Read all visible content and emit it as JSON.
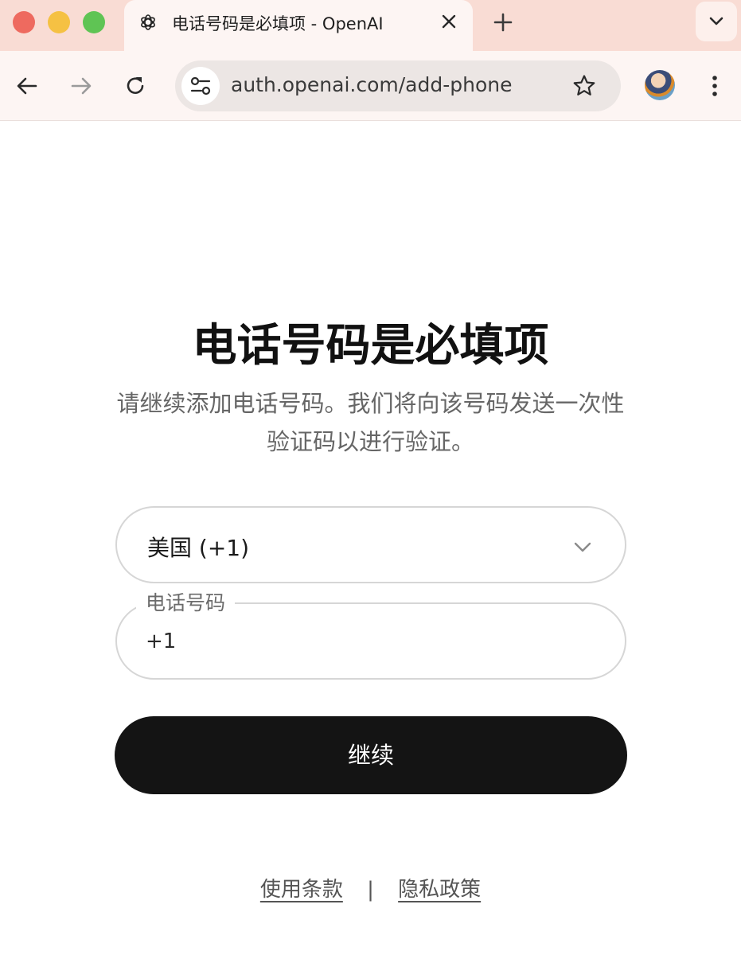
{
  "browser": {
    "tab": {
      "title": "电话号码是必填项 - OpenAI",
      "favicon": "openai-logo-icon"
    },
    "url": "auth.openai.com/add-phone",
    "icons": {
      "back": "arrow-left-icon",
      "forward": "arrow-right-icon",
      "reload": "reload-icon",
      "site_info": "tune-icon",
      "bookmark": "star-icon",
      "menu": "more-vert-icon",
      "new_tab": "plus-icon",
      "close_tab": "close-icon",
      "tab_search": "chevron-down-icon"
    },
    "colors": {
      "tabstrip_bg": "#f9dcd4",
      "toolbar_bg": "#fdf5f3",
      "omnibox_bg": "#ece6e4"
    }
  },
  "page": {
    "title": "电话号码是必填项",
    "subtitle": "请继续添加电话号码。我们将向该号码发送一次性验证码以进行验证。",
    "country_select": {
      "value": "美国 (+1)"
    },
    "phone_field": {
      "label": "电话号码",
      "value": "+1"
    },
    "continue_label": "继续",
    "footer": {
      "terms": "使用条款",
      "separator": "|",
      "privacy": "隐私政策"
    },
    "colors": {
      "button_bg": "#141414",
      "button_text": "#ffffff",
      "border": "#d6d6d6"
    }
  }
}
